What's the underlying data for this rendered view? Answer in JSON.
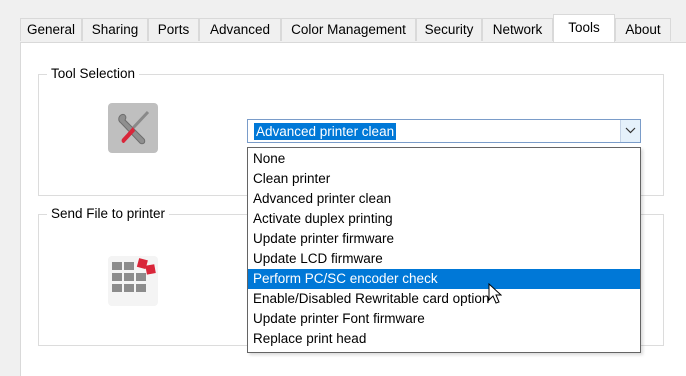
{
  "tabs": [
    {
      "label": "General"
    },
    {
      "label": "Sharing"
    },
    {
      "label": "Ports"
    },
    {
      "label": "Advanced"
    },
    {
      "label": "Color Management"
    },
    {
      "label": "Security"
    },
    {
      "label": "Network"
    },
    {
      "label": "Tools",
      "active": true
    },
    {
      "label": "About"
    }
  ],
  "tool_selection": {
    "title": "Tool Selection",
    "icon": "printer-tools-icon",
    "selected_value": "Advanced printer clean"
  },
  "send_file": {
    "title": "Send File to printer",
    "icon": "send-file-icon"
  },
  "dropdown": {
    "options": [
      "None",
      "Clean printer",
      "Advanced printer clean",
      "Activate duplex printing",
      "Update printer firmware",
      "Update LCD firmware",
      "Perform PC/SC encoder check",
      "Enable/Disabled Rewritable card option",
      "Update printer Font firmware",
      "Replace print head"
    ],
    "highlighted_index": 6
  },
  "colors": {
    "selection": "#0078d7",
    "accent_red": "#d9263a"
  }
}
